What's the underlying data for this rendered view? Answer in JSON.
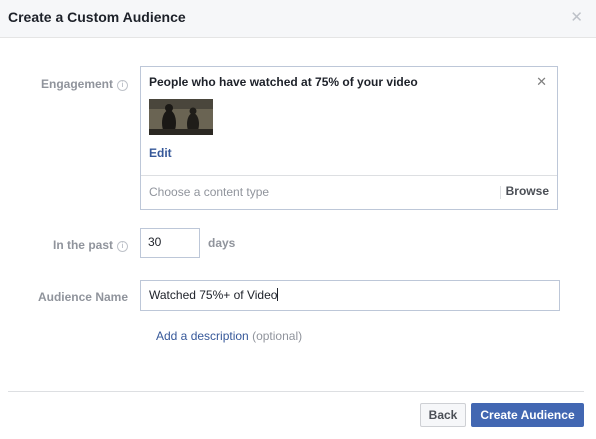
{
  "dialog": {
    "title": "Create a Custom Audience",
    "close_icon": "close-icon"
  },
  "engagement": {
    "label": "Engagement",
    "info_icon": "info-icon",
    "selection_title": "People who have watched at 75% of your video",
    "remove_icon": "close-icon",
    "thumbnail_icon": "video-thumbnail",
    "edit_label": "Edit",
    "content_type_placeholder": "Choose a content type",
    "browse_label": "Browse"
  },
  "in_the_past": {
    "label": "In the past",
    "info_icon": "info-icon",
    "value": "30",
    "unit": "days"
  },
  "audience_name": {
    "label": "Audience Name",
    "value": "Watched 75%+ of Video"
  },
  "description": {
    "link_label": "Add a description",
    "optional_label": "(optional)"
  },
  "footer": {
    "back_label": "Back",
    "create_label": "Create Audience"
  },
  "colors": {
    "header_bg": "#f6f7f9",
    "primary_button": "#4267b2",
    "link": "#365899",
    "label": "#90949c",
    "border": "#bdc7d8"
  }
}
